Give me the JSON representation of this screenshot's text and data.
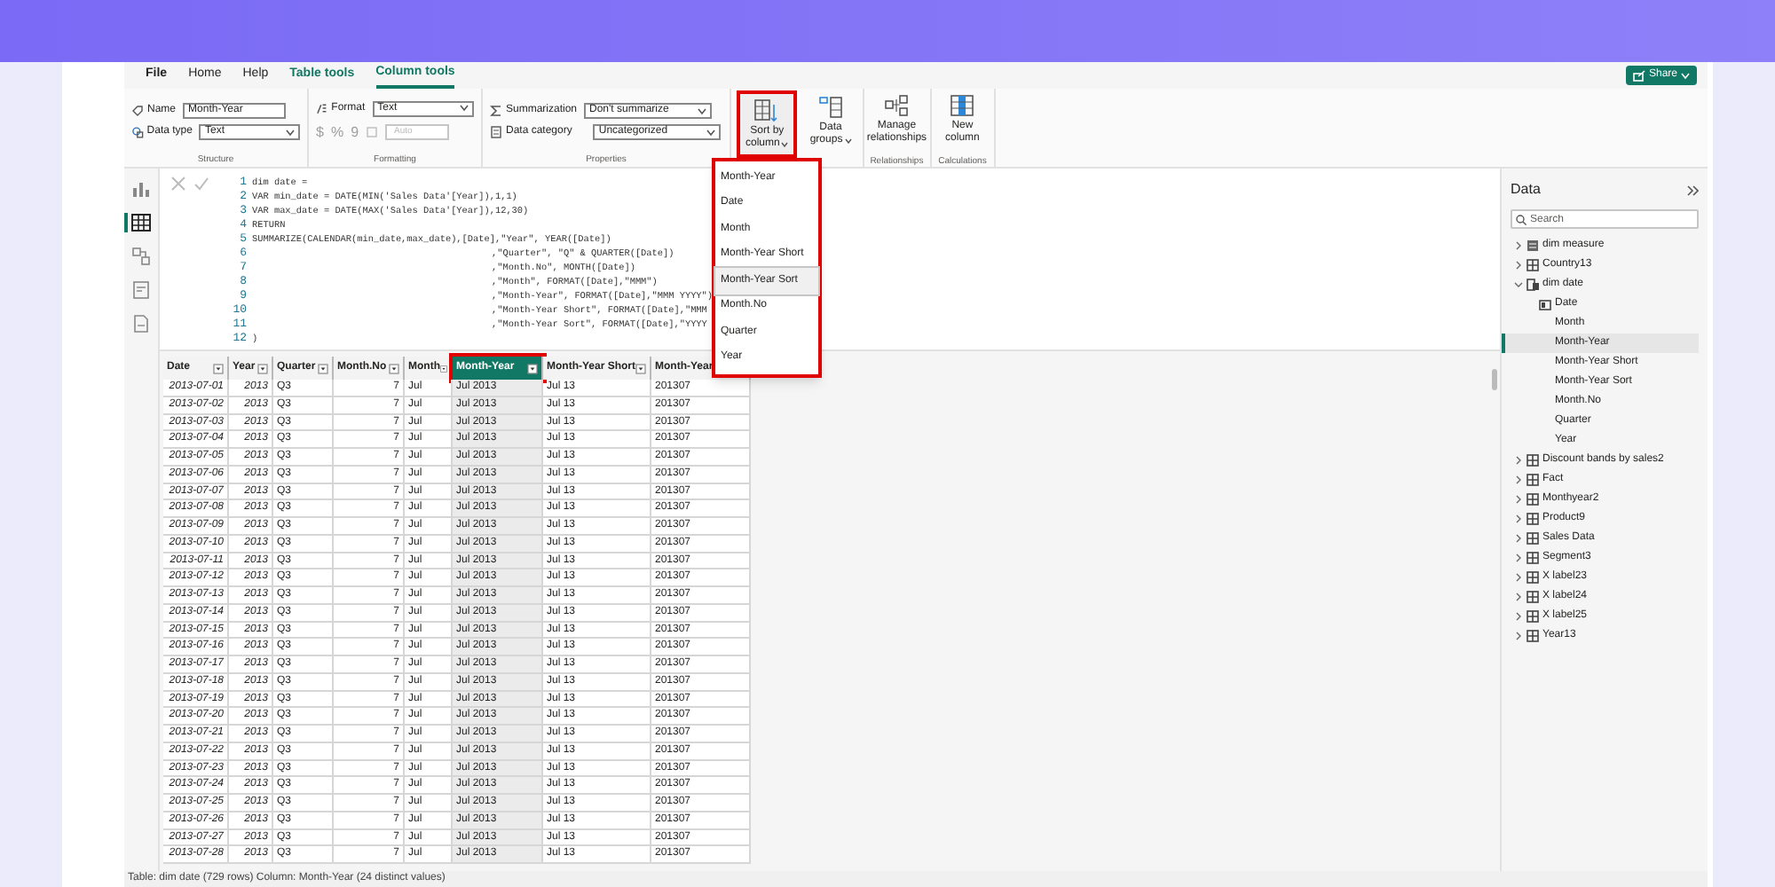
{
  "tabs": [
    {
      "label": "File",
      "selected": false
    },
    {
      "label": "Home",
      "selected": false
    },
    {
      "label": "Help",
      "selected": false
    },
    {
      "label": "Table tools",
      "selected": false
    },
    {
      "label": "Column tools",
      "selected": true
    }
  ],
  "share_button": "Share",
  "ribbon": {
    "structure": {
      "name_label": "Name",
      "name_value": "Month-Year",
      "type_label": "Data type",
      "type_value": "Text",
      "group": "Structure"
    },
    "formatting": {
      "format_label": "Format",
      "format_value": "Text",
      "currency": "$",
      "percent": "%",
      "comma": "9",
      "decimals_value": "Auto",
      "group": "Formatting"
    },
    "properties": {
      "summarization_label": "Summarization",
      "summarization_value": "Don't summarize",
      "category_label": "Data category",
      "category_value": "Uncategorized",
      "group": "Properties"
    },
    "sort_button": {
      "line1": "Sort by",
      "line2": "column",
      "highlighted": true
    },
    "data_groups": {
      "line1": "Data",
      "line2": "groups"
    },
    "manage_rel": {
      "line1": "Manage",
      "line2": "relationships",
      "group": "Relationships"
    },
    "new_column": {
      "line1": "New",
      "line2": "column",
      "group": "Calculations"
    }
  },
  "sort_menu": {
    "highlighted": true,
    "items": [
      {
        "label": "Month-Year",
        "selected": false
      },
      {
        "label": "Date",
        "selected": false
      },
      {
        "label": "Month",
        "selected": false
      },
      {
        "label": "Month-Year Short",
        "selected": false
      },
      {
        "label": "Month-Year Sort",
        "selected": true
      },
      {
        "label": "Month.No",
        "selected": false
      },
      {
        "label": "Quarter",
        "selected": false
      },
      {
        "label": "Year",
        "selected": false
      }
    ]
  },
  "rail": [
    {
      "kind": "report",
      "selected": false
    },
    {
      "kind": "table",
      "selected": true
    },
    {
      "kind": "model",
      "selected": false
    },
    {
      "kind": "dax",
      "selected": false
    },
    {
      "kind": "tmdl",
      "selected": false
    }
  ],
  "code_lines": [
    {
      "n": "1",
      "text": "dim date ="
    },
    {
      "n": "2",
      "text": "VAR min_date = DATE(MIN('Sales Data'[Year]),1,1)"
    },
    {
      "n": "3",
      "text": "VAR max_date = DATE(MAX('Sales Data'[Year]),12,30)"
    },
    {
      "n": "4",
      "text": "RETURN"
    },
    {
      "n": "5",
      "text": "SUMMARIZE(CALENDAR(min_date,max_date),[Date],\"Year\", YEAR([Date])"
    },
    {
      "n": "6",
      "text": ",\"Quarter\", \"Q\" & QUARTER([Date])"
    },
    {
      "n": "7",
      "text": ",\"Month.No\", MONTH([Date])"
    },
    {
      "n": "8",
      "text": ",\"Month\", FORMAT([Date],\"MMM\")"
    },
    {
      "n": "9",
      "text": ",\"Month-Year\", FORMAT([Date],\"MMM YYYY\")"
    },
    {
      "n": "10",
      "text": ",\"Month-Year Short\", FORMAT([Date],\"MMM"
    },
    {
      "n": "11",
      "text": ",\"Month-Year Sort\", FORMAT([Date],\"YYYY"
    },
    {
      "n": "12",
      "text": ")"
    }
  ],
  "table": {
    "columns": [
      {
        "label": "Date",
        "selected": false
      },
      {
        "label": "Year",
        "selected": false
      },
      {
        "label": "Quarter",
        "selected": false
      },
      {
        "label": "Month.No",
        "selected": false
      },
      {
        "label": "Month",
        "selected": false
      },
      {
        "label": "Month-Year",
        "selected": true
      },
      {
        "label": "Month-Year Short",
        "selected": false
      },
      {
        "label": "Month-Year",
        "selected": false
      }
    ],
    "rows": [
      [
        "2013-07-01",
        "2013",
        "Q3",
        "7",
        "Jul",
        "Jul 2013",
        "Jul 13",
        "201307"
      ],
      [
        "2013-07-02",
        "2013",
        "Q3",
        "7",
        "Jul",
        "Jul 2013",
        "Jul 13",
        "201307"
      ],
      [
        "2013-07-03",
        "2013",
        "Q3",
        "7",
        "Jul",
        "Jul 2013",
        "Jul 13",
        "201307"
      ],
      [
        "2013-07-04",
        "2013",
        "Q3",
        "7",
        "Jul",
        "Jul 2013",
        "Jul 13",
        "201307"
      ],
      [
        "2013-07-05",
        "2013",
        "Q3",
        "7",
        "Jul",
        "Jul 2013",
        "Jul 13",
        "201307"
      ],
      [
        "2013-07-06",
        "2013",
        "Q3",
        "7",
        "Jul",
        "Jul 2013",
        "Jul 13",
        "201307"
      ],
      [
        "2013-07-07",
        "2013",
        "Q3",
        "7",
        "Jul",
        "Jul 2013",
        "Jul 13",
        "201307"
      ],
      [
        "2013-07-08",
        "2013",
        "Q3",
        "7",
        "Jul",
        "Jul 2013",
        "Jul 13",
        "201307"
      ],
      [
        "2013-07-09",
        "2013",
        "Q3",
        "7",
        "Jul",
        "Jul 2013",
        "Jul 13",
        "201307"
      ],
      [
        "2013-07-10",
        "2013",
        "Q3",
        "7",
        "Jul",
        "Jul 2013",
        "Jul 13",
        "201307"
      ],
      [
        "2013-07-11",
        "2013",
        "Q3",
        "7",
        "Jul",
        "Jul 2013",
        "Jul 13",
        "201307"
      ],
      [
        "2013-07-12",
        "2013",
        "Q3",
        "7",
        "Jul",
        "Jul 2013",
        "Jul 13",
        "201307"
      ],
      [
        "2013-07-13",
        "2013",
        "Q3",
        "7",
        "Jul",
        "Jul 2013",
        "Jul 13",
        "201307"
      ],
      [
        "2013-07-14",
        "2013",
        "Q3",
        "7",
        "Jul",
        "Jul 2013",
        "Jul 13",
        "201307"
      ],
      [
        "2013-07-15",
        "2013",
        "Q3",
        "7",
        "Jul",
        "Jul 2013",
        "Jul 13",
        "201307"
      ],
      [
        "2013-07-16",
        "2013",
        "Q3",
        "7",
        "Jul",
        "Jul 2013",
        "Jul 13",
        "201307"
      ],
      [
        "2013-07-17",
        "2013",
        "Q3",
        "7",
        "Jul",
        "Jul 2013",
        "Jul 13",
        "201307"
      ],
      [
        "2013-07-18",
        "2013",
        "Q3",
        "7",
        "Jul",
        "Jul 2013",
        "Jul 13",
        "201307"
      ],
      [
        "2013-07-19",
        "2013",
        "Q3",
        "7",
        "Jul",
        "Jul 2013",
        "Jul 13",
        "201307"
      ],
      [
        "2013-07-20",
        "2013",
        "Q3",
        "7",
        "Jul",
        "Jul 2013",
        "Jul 13",
        "201307"
      ],
      [
        "2013-07-21",
        "2013",
        "Q3",
        "7",
        "Jul",
        "Jul 2013",
        "Jul 13",
        "201307"
      ],
      [
        "2013-07-22",
        "2013",
        "Q3",
        "7",
        "Jul",
        "Jul 2013",
        "Jul 13",
        "201307"
      ],
      [
        "2013-07-23",
        "2013",
        "Q3",
        "7",
        "Jul",
        "Jul 2013",
        "Jul 13",
        "201307"
      ],
      [
        "2013-07-24",
        "2013",
        "Q3",
        "7",
        "Jul",
        "Jul 2013",
        "Jul 13",
        "201307"
      ],
      [
        "2013-07-25",
        "2013",
        "Q3",
        "7",
        "Jul",
        "Jul 2013",
        "Jul 13",
        "201307"
      ],
      [
        "2013-07-26",
        "2013",
        "Q3",
        "7",
        "Jul",
        "Jul 2013",
        "Jul 13",
        "201307"
      ],
      [
        "2013-07-27",
        "2013",
        "Q3",
        "7",
        "Jul",
        "Jul 2013",
        "Jul 13",
        "201307"
      ],
      [
        "2013-07-28",
        "2013",
        "Q3",
        "7",
        "Jul",
        "Jul 2013",
        "Jul 13",
        "201307"
      ]
    ]
  },
  "data_pane": {
    "title": "Data",
    "search_placeholder": "Search",
    "items": [
      {
        "label": "dim measure",
        "kind": "measure-table",
        "expanded": false
      },
      {
        "label": "Country13",
        "kind": "table",
        "expanded": false
      },
      {
        "label": "dim date",
        "kind": "calendar-table",
        "expanded": true,
        "children": [
          {
            "label": "Date",
            "kind": "date",
            "selected": false
          },
          {
            "label": "Month",
            "kind": "text",
            "selected": false
          },
          {
            "label": "Month-Year",
            "kind": "text",
            "selected": true
          },
          {
            "label": "Month-Year Short",
            "kind": "text",
            "selected": false
          },
          {
            "label": "Month-Year Sort",
            "kind": "text",
            "selected": false
          },
          {
            "label": "Month.No",
            "kind": "text",
            "selected": false
          },
          {
            "label": "Quarter",
            "kind": "text",
            "selected": false
          },
          {
            "label": "Year",
            "kind": "text",
            "selected": false
          }
        ]
      },
      {
        "label": "Discount bands by sales2",
        "kind": "table",
        "expanded": false
      },
      {
        "label": "Fact",
        "kind": "table",
        "expanded": false
      },
      {
        "label": "Monthyear2",
        "kind": "table",
        "expanded": false
      },
      {
        "label": "Product9",
        "kind": "table",
        "expanded": false
      },
      {
        "label": "Sales Data",
        "kind": "table",
        "expanded": false
      },
      {
        "label": "Segment3",
        "kind": "table",
        "expanded": false
      },
      {
        "label": "X label23",
        "kind": "table",
        "expanded": false
      },
      {
        "label": "X label24",
        "kind": "table",
        "expanded": false
      },
      {
        "label": "X label25",
        "kind": "table",
        "expanded": false
      },
      {
        "label": "Year13",
        "kind": "table",
        "expanded": false
      }
    ]
  },
  "status_bar": "Table: dim date (729 rows) Column: Month-Year (24 distinct values)"
}
